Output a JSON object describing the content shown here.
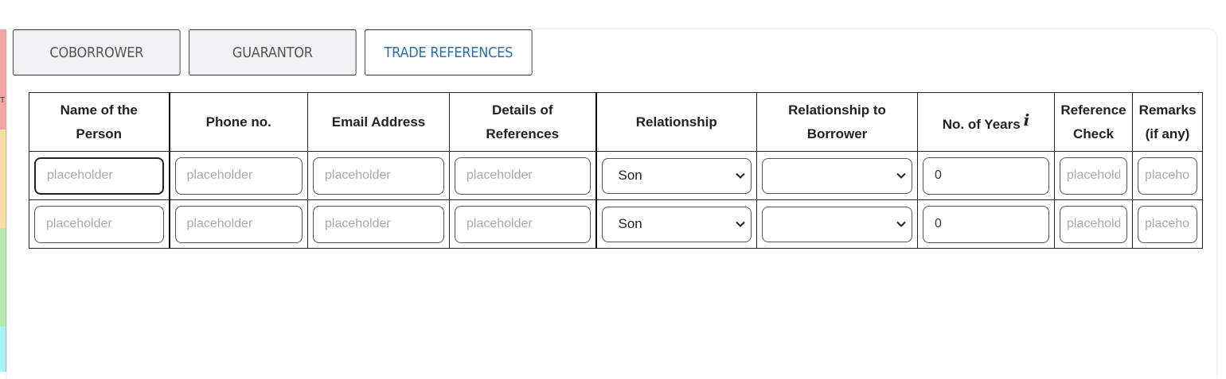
{
  "tabs": [
    {
      "label": "COBORROWER"
    },
    {
      "label": "GUARANTOR"
    },
    {
      "label": "TRADE REFERENCES",
      "active": true
    }
  ],
  "left_strip_char": "T",
  "table": {
    "headers": {
      "name": [
        "Name of the",
        "Person"
      ],
      "phone": "Phone no.",
      "email": "Email Address",
      "details": [
        "Details of",
        "References"
      ],
      "relationship": "Relationship",
      "rel_borrower": [
        "Relationship to",
        "Borrower"
      ],
      "years": "No. of Years",
      "years_icon": "info-icon",
      "ref_check": [
        "Reference",
        "Check"
      ],
      "remarks": [
        "Remarks",
        "(if any)"
      ]
    },
    "rows": [
      {
        "name_placeholder": "placeholder",
        "phone_placeholder": "placeholder",
        "email_placeholder": "placeholder",
        "details_placeholder": "placeholder",
        "relationship": "Son",
        "rel_borrower": "",
        "years": "0",
        "ref_check_placeholder": "placeholder",
        "remarks_placeholder": "placeholder"
      },
      {
        "name_placeholder": "placeholder",
        "phone_placeholder": "placeholder",
        "email_placeholder": "placeholder",
        "details_placeholder": "placeholder",
        "relationship": "Son",
        "rel_borrower": "",
        "years": "0",
        "ref_check_placeholder": "placeholder",
        "remarks_placeholder": "placeholder"
      }
    ]
  },
  "colors": {
    "active_tab_text": "#2a6fb0",
    "inactive_tab_bg": "#f1f2f4"
  }
}
